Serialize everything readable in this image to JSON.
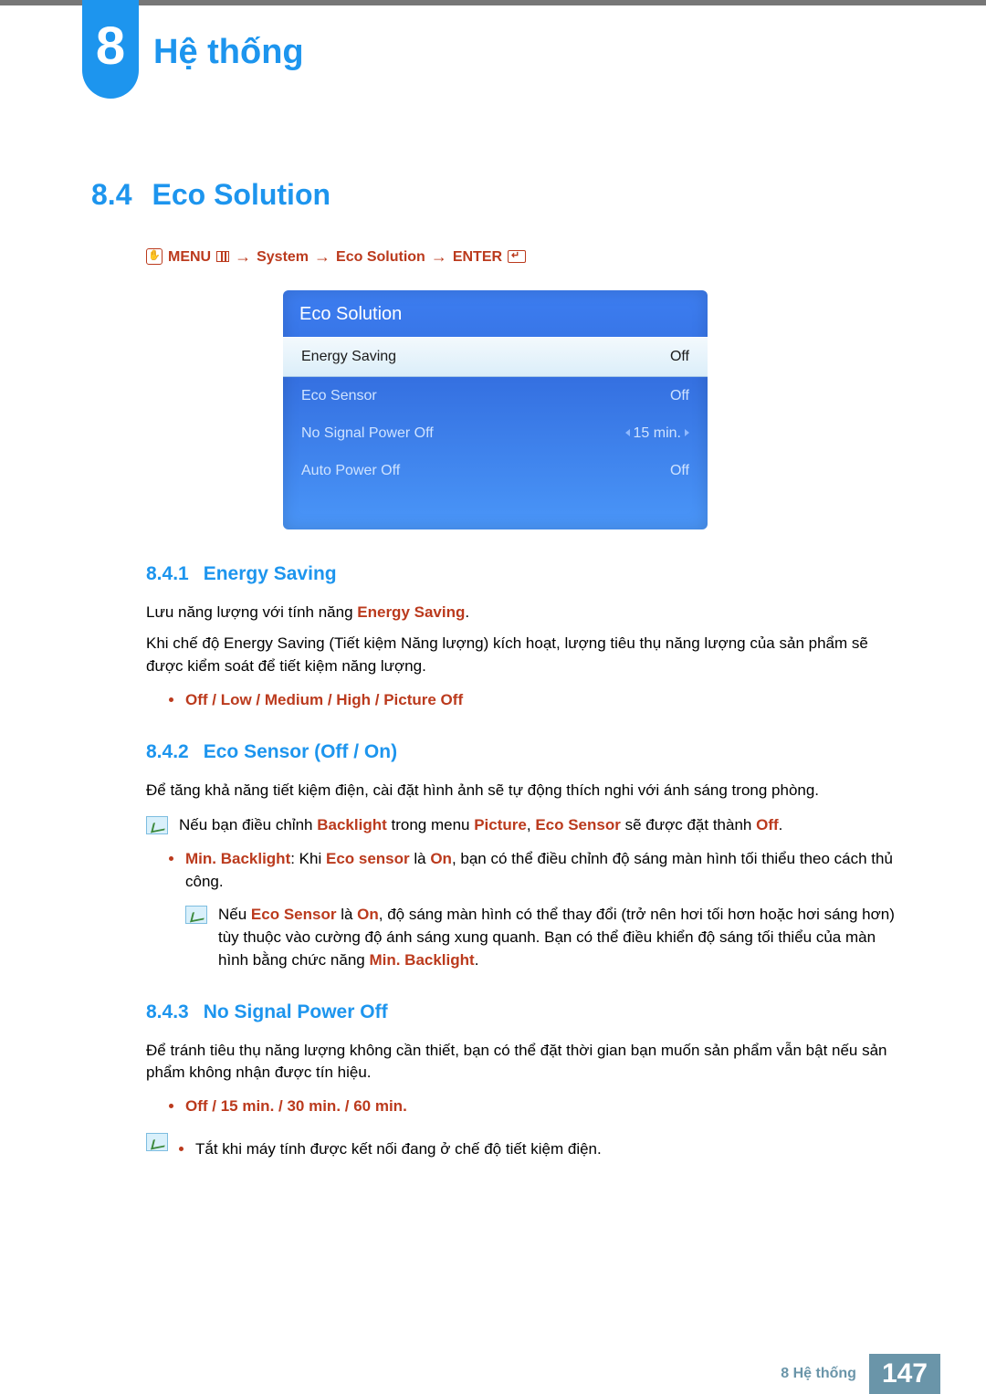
{
  "chapter": {
    "number": "8",
    "title": "Hệ thống"
  },
  "section": {
    "number": "8.4",
    "title": "Eco Solution"
  },
  "menu_path": {
    "menu_label": "MENU",
    "steps": [
      "System",
      "Eco Solution"
    ],
    "enter_label": "ENTER"
  },
  "osd": {
    "title": "Eco Solution",
    "rows": [
      {
        "label": "Energy Saving",
        "value": "Off",
        "selected": true
      },
      {
        "label": "Eco Sensor",
        "value": "Off",
        "selected": false
      },
      {
        "label": "No Signal Power Off",
        "value": "15 min.",
        "selected": false
      },
      {
        "label": "Auto Power Off",
        "value": "Off",
        "selected": false
      }
    ]
  },
  "s841": {
    "num": "8.4.1",
    "title": "Energy Saving",
    "p1_pre": "Lưu năng lượng với tính năng ",
    "p1_hl": "Energy Saving",
    "p1_post": ".",
    "p2": "Khi chế độ Energy Saving (Tiết kiệm Năng lượng) kích hoạt, lượng tiêu thụ năng lượng của sản phẩm sẽ được kiểm soát để tiết kiệm năng lượng.",
    "options": "Off / Low / Medium / High / Picture Off"
  },
  "s842": {
    "num": "8.4.2",
    "title": "Eco Sensor (Off / On)",
    "p1": "Để tăng khả năng tiết kiệm điện, cài đặt hình ảnh sẽ tự động thích nghi với ánh sáng trong phòng.",
    "note1_a": "Nếu bạn điều chỉnh ",
    "note1_hl1": "Backlight",
    "note1_b": " trong menu ",
    "note1_hl2": "Picture",
    "note1_c": ", ",
    "note1_hl3": "Eco Sensor",
    "note1_d": " sẽ được đặt thành ",
    "note1_hl4": "Off",
    "note1_e": ".",
    "li_hl1": "Min. Backlight",
    "li_a": ": Khi ",
    "li_hl2": "Eco sensor",
    "li_b": " là ",
    "li_hl3": "On",
    "li_c": ", bạn có thể điều chỉnh độ sáng màn hình tối thiểu theo cách thủ công.",
    "subnote_a": "Nếu ",
    "subnote_hl1": "Eco Sensor",
    "subnote_b": " là ",
    "subnote_hl2": "On",
    "subnote_c": ", độ sáng màn hình có thể thay đổi (trở nên hơi tối hơn hoặc hơi sáng hơn) tùy thuộc vào cường độ ánh sáng xung quanh. Bạn có thể điều khiển độ sáng tối thiểu của màn hình bằng chức năng ",
    "subnote_hl3": "Min. Backlight",
    "subnote_d": "."
  },
  "s843": {
    "num": "8.4.3",
    "title": "No Signal Power Off",
    "p1": "Để tránh tiêu thụ năng lượng không cần thiết, bạn có thể đặt thời gian bạn muốn sản phẩm vẫn bật nếu sản phẩm không nhận được tín hiệu.",
    "options": "Off / 15 min. / 30 min. / 60 min.",
    "note1": "Tắt khi máy tính được kết nối đang ở chế độ tiết kiệm điện."
  },
  "footer": {
    "label": "8 Hệ thống",
    "page": "147"
  }
}
